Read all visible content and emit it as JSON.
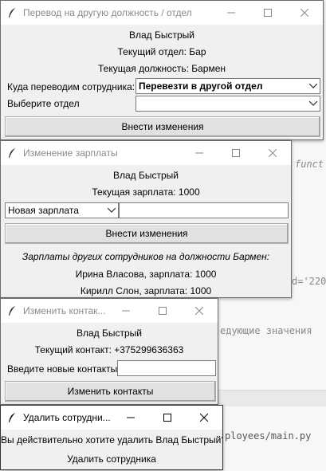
{
  "ide": {
    "fragment_funct": "funct",
    "fragment_220": "d='220",
    "fragment_next_values": "едующие значения",
    "fragment_main_py": "ployees/main.py"
  },
  "windows": {
    "transfer": {
      "title": "Перевод на другую должность / отдел",
      "employee_name": "Влад Быстрый",
      "current_department": "Текущий отдел: Бар",
      "current_position": "Текущая должность: Бармен",
      "transfer_label": "Куда переводим сотрудника:",
      "transfer_value": "Перевезти в другой отдел",
      "choose_department_label": "Выберите отдел",
      "choose_department_value": "",
      "apply_button": "Внести изменения"
    },
    "salary": {
      "title": "Изменение зарплаты",
      "employee_name": "Влад Быстрый",
      "current_salary": "Текущая зарплата: 1000",
      "new_salary_option": "Новая зарплата",
      "new_salary_value": "",
      "apply_button": "Внести изменения",
      "others_header": "Зарплаты других сотрудников на должности Бармен:",
      "others": [
        "Ирина Власова, зарплата: 1000",
        "Кирилл Слон, зарплата: 1000"
      ]
    },
    "contacts": {
      "title": "Изменить контак...",
      "employee_name": "Влад Быстрый",
      "current_contact": "Текущий контакт: +375299636363",
      "new_contacts_label": "Введите новые контакты",
      "new_contacts_value": "",
      "apply_button": "Изменить контакты"
    },
    "delete": {
      "title": "Удалить сотрудни...",
      "confirm_text": "Вы действительно хотите удалить Влад Быстрый?",
      "delete_button": "Удалить сотрудника"
    }
  }
}
